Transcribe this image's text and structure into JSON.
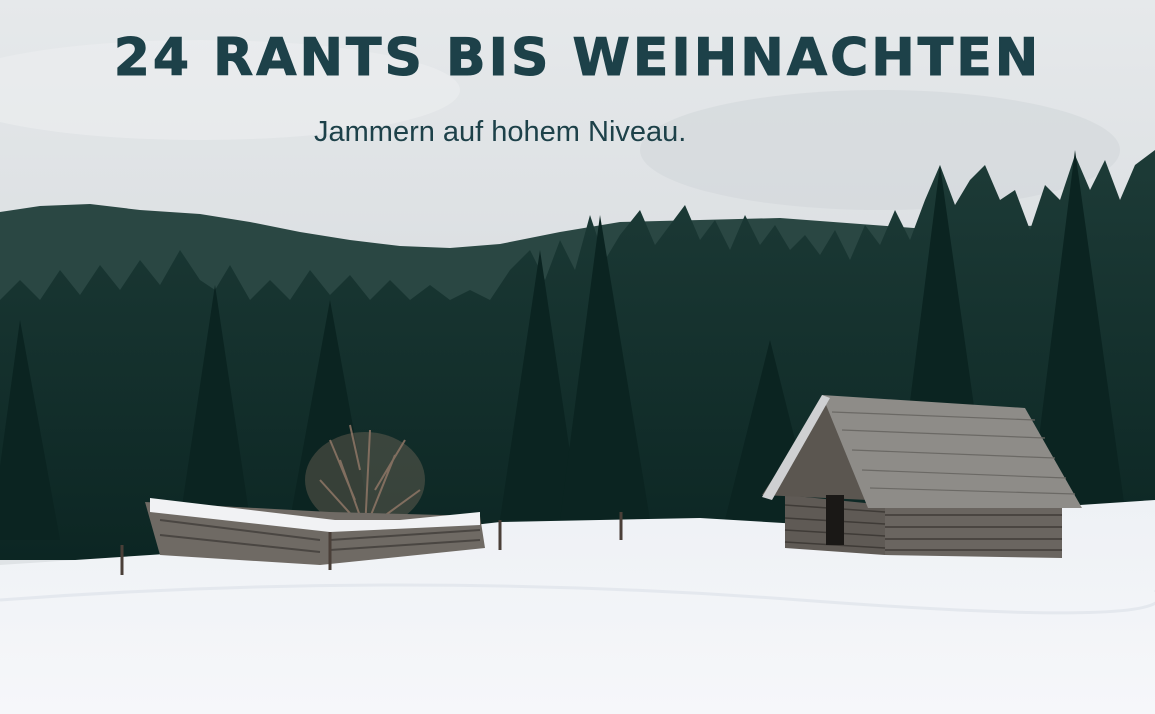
{
  "header": {
    "title": "24 RANTS BIS WEIHNACHTEN",
    "subtitle": "Jammern auf hohem Niveau."
  },
  "colors": {
    "text": "#1d4149",
    "sky": "#dfe3e6",
    "forest": "#10302c",
    "snow": "#f3f5f8",
    "wood": "#6e6a64"
  },
  "scene": {
    "elements": [
      "cloudy-sky",
      "pine-forest",
      "snow-field",
      "collapsed-hut",
      "log-cabin",
      "bare-bush",
      "fence-posts"
    ]
  }
}
